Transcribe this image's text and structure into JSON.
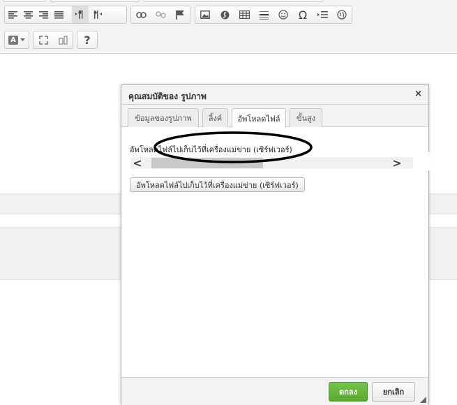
{
  "dialog": {
    "title": "คุณสมบัติของ รูปภาพ",
    "close_symbol": "×",
    "tabs": [
      {
        "label": "ข้อมูลของรูปภาพ"
      },
      {
        "label": "ลิ้งค์"
      },
      {
        "label": "อัพโหลดไฟล์"
      },
      {
        "label": "ขั้นสูง"
      }
    ],
    "active_tab": "อัพโหลดไฟล์",
    "upload_label": "อัพโหลดไฟล์ไปเก็บไว้ที่เครื่องแม่ข่าย (เซิร์ฟเวอร์)",
    "scroll_left": "<",
    "scroll_right": ">",
    "upload_button": "อัพโหลดไฟล์ไปเก็บไว้ที่เครื่องแม่ข่าย (เซิร์ฟเวอร์)",
    "ok_button": "ตกลง",
    "cancel_button": "ยกเลิก"
  },
  "toolbar": {
    "help_symbol": "?",
    "show_blocks_symbol": "¶",
    "text_color_symbol": "A",
    "special_char_symbol": "Ω",
    "icons": [
      "align-left-icon",
      "align-center-icon",
      "align-right-icon",
      "align-justify-icon",
      "ltr-icon",
      "rtl-icon",
      "link-icon",
      "unlink-icon",
      "anchor-icon",
      "image-icon",
      "flash-icon",
      "table-icon",
      "horizontal-rule-icon",
      "smiley-icon",
      "special-char-icon",
      "page-break-icon",
      "iframe-icon",
      "text-color-icon",
      "maximize-icon",
      "show-blocks-icon",
      "help-icon"
    ]
  },
  "colors": {
    "ok_green": "#5aa830",
    "toolbar_bg": "#f3f3f3"
  }
}
